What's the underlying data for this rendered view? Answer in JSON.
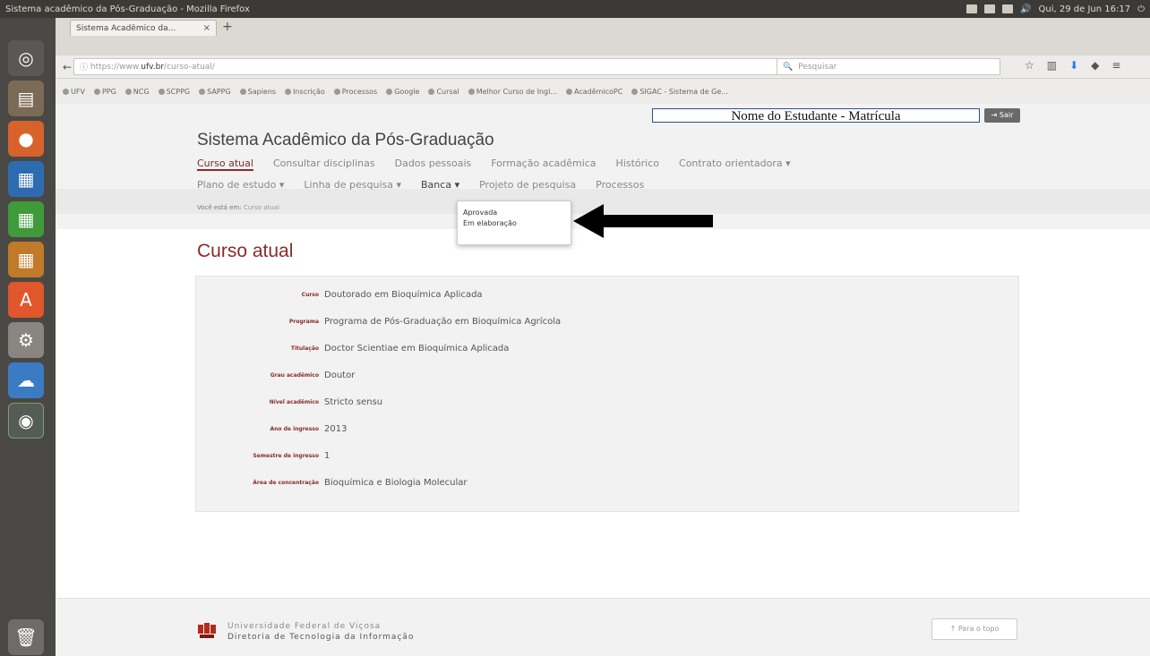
{
  "os_panel": {
    "window_title": "Sistema acadêmico da Pós-Graduação - Mozilla Firefox",
    "clock": "Qui, 29 de Jun 16:17"
  },
  "browser": {
    "tab_title": "Sistema Acadêmico da...",
    "url_prefix": "https://www.",
    "url_domain": "ufv.br",
    "url_path": "/curso-atual/",
    "search_placeholder": "Pesquisar",
    "bookmarks": [
      "UFV",
      "PPG",
      "NCG",
      "SCPPG",
      "SAPPG",
      "Sapiens",
      "Inscrição",
      "Processos",
      "Google",
      "Cursal",
      "Melhor Curso de Ingl...",
      "AcadêmicoPC",
      "SIGAC - Sistema de Ge..."
    ]
  },
  "header": {
    "student_field": "Nome do Estudante - Matrícula",
    "exit_label": "Sair",
    "site_title": "Sistema Acadêmico da Pós-Graduação"
  },
  "menu": {
    "row1": [
      "Curso atual",
      "Consultar disciplinas",
      "Dados pessoais",
      "Formação acadêmica",
      "Histórico",
      "Contrato orientadora"
    ],
    "row2": [
      "Plano de estudo",
      "Linha de pesquisa",
      "Banca",
      "Projeto de pesquisa",
      "Processos"
    ]
  },
  "breadcrumb": {
    "label": "Você está em:",
    "current": "Curso atual"
  },
  "dropdown": {
    "items": [
      "Aprovada",
      "Em elaboração"
    ]
  },
  "page": {
    "heading": "Curso atual"
  },
  "info": [
    {
      "label": "Curso",
      "value": "Doutorado em Bioquímica Aplicada"
    },
    {
      "label": "Programa",
      "value": "Programa de Pós-Graduação em Bioquímica Agrícola"
    },
    {
      "label": "Titulação",
      "value": "Doctor Scientiae em Bioquímica Aplicada"
    },
    {
      "label": "Grau acadêmico",
      "value": "Doutor"
    },
    {
      "label": "Nível acadêmico",
      "value": "Stricto sensu"
    },
    {
      "label": "Ano de ingresso",
      "value": "2013"
    },
    {
      "label": "Semestre de ingresso",
      "value": "1"
    },
    {
      "label": "Área de concentração",
      "value": "Bioquímica e Biologia Molecular"
    }
  ],
  "footer": {
    "line1": "Universidade Federal de Viçosa",
    "line2": "Diretoria de Tecnologia da Informação",
    "top_button": "Para o topo"
  }
}
